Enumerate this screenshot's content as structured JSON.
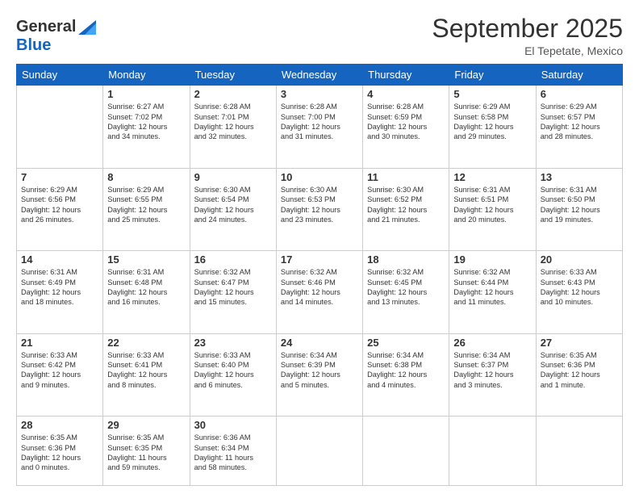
{
  "header": {
    "logo_general": "General",
    "logo_blue": "Blue",
    "month_title": "September 2025",
    "subtitle": "El Tepetate, Mexico"
  },
  "weekdays": [
    "Sunday",
    "Monday",
    "Tuesday",
    "Wednesday",
    "Thursday",
    "Friday",
    "Saturday"
  ],
  "weeks": [
    [
      {
        "day": "",
        "text": ""
      },
      {
        "day": "1",
        "text": "Sunrise: 6:27 AM\nSunset: 7:02 PM\nDaylight: 12 hours\nand 34 minutes."
      },
      {
        "day": "2",
        "text": "Sunrise: 6:28 AM\nSunset: 7:01 PM\nDaylight: 12 hours\nand 32 minutes."
      },
      {
        "day": "3",
        "text": "Sunrise: 6:28 AM\nSunset: 7:00 PM\nDaylight: 12 hours\nand 31 minutes."
      },
      {
        "day": "4",
        "text": "Sunrise: 6:28 AM\nSunset: 6:59 PM\nDaylight: 12 hours\nand 30 minutes."
      },
      {
        "day": "5",
        "text": "Sunrise: 6:29 AM\nSunset: 6:58 PM\nDaylight: 12 hours\nand 29 minutes."
      },
      {
        "day": "6",
        "text": "Sunrise: 6:29 AM\nSunset: 6:57 PM\nDaylight: 12 hours\nand 28 minutes."
      }
    ],
    [
      {
        "day": "7",
        "text": "Sunrise: 6:29 AM\nSunset: 6:56 PM\nDaylight: 12 hours\nand 26 minutes."
      },
      {
        "day": "8",
        "text": "Sunrise: 6:29 AM\nSunset: 6:55 PM\nDaylight: 12 hours\nand 25 minutes."
      },
      {
        "day": "9",
        "text": "Sunrise: 6:30 AM\nSunset: 6:54 PM\nDaylight: 12 hours\nand 24 minutes."
      },
      {
        "day": "10",
        "text": "Sunrise: 6:30 AM\nSunset: 6:53 PM\nDaylight: 12 hours\nand 23 minutes."
      },
      {
        "day": "11",
        "text": "Sunrise: 6:30 AM\nSunset: 6:52 PM\nDaylight: 12 hours\nand 21 minutes."
      },
      {
        "day": "12",
        "text": "Sunrise: 6:31 AM\nSunset: 6:51 PM\nDaylight: 12 hours\nand 20 minutes."
      },
      {
        "day": "13",
        "text": "Sunrise: 6:31 AM\nSunset: 6:50 PM\nDaylight: 12 hours\nand 19 minutes."
      }
    ],
    [
      {
        "day": "14",
        "text": "Sunrise: 6:31 AM\nSunset: 6:49 PM\nDaylight: 12 hours\nand 18 minutes."
      },
      {
        "day": "15",
        "text": "Sunrise: 6:31 AM\nSunset: 6:48 PM\nDaylight: 12 hours\nand 16 minutes."
      },
      {
        "day": "16",
        "text": "Sunrise: 6:32 AM\nSunset: 6:47 PM\nDaylight: 12 hours\nand 15 minutes."
      },
      {
        "day": "17",
        "text": "Sunrise: 6:32 AM\nSunset: 6:46 PM\nDaylight: 12 hours\nand 14 minutes."
      },
      {
        "day": "18",
        "text": "Sunrise: 6:32 AM\nSunset: 6:45 PM\nDaylight: 12 hours\nand 13 minutes."
      },
      {
        "day": "19",
        "text": "Sunrise: 6:32 AM\nSunset: 6:44 PM\nDaylight: 12 hours\nand 11 minutes."
      },
      {
        "day": "20",
        "text": "Sunrise: 6:33 AM\nSunset: 6:43 PM\nDaylight: 12 hours\nand 10 minutes."
      }
    ],
    [
      {
        "day": "21",
        "text": "Sunrise: 6:33 AM\nSunset: 6:42 PM\nDaylight: 12 hours\nand 9 minutes."
      },
      {
        "day": "22",
        "text": "Sunrise: 6:33 AM\nSunset: 6:41 PM\nDaylight: 12 hours\nand 8 minutes."
      },
      {
        "day": "23",
        "text": "Sunrise: 6:33 AM\nSunset: 6:40 PM\nDaylight: 12 hours\nand 6 minutes."
      },
      {
        "day": "24",
        "text": "Sunrise: 6:34 AM\nSunset: 6:39 PM\nDaylight: 12 hours\nand 5 minutes."
      },
      {
        "day": "25",
        "text": "Sunrise: 6:34 AM\nSunset: 6:38 PM\nDaylight: 12 hours\nand 4 minutes."
      },
      {
        "day": "26",
        "text": "Sunrise: 6:34 AM\nSunset: 6:37 PM\nDaylight: 12 hours\nand 3 minutes."
      },
      {
        "day": "27",
        "text": "Sunrise: 6:35 AM\nSunset: 6:36 PM\nDaylight: 12 hours\nand 1 minute."
      }
    ],
    [
      {
        "day": "28",
        "text": "Sunrise: 6:35 AM\nSunset: 6:36 PM\nDaylight: 12 hours\nand 0 minutes."
      },
      {
        "day": "29",
        "text": "Sunrise: 6:35 AM\nSunset: 6:35 PM\nDaylight: 11 hours\nand 59 minutes."
      },
      {
        "day": "30",
        "text": "Sunrise: 6:36 AM\nSunset: 6:34 PM\nDaylight: 11 hours\nand 58 minutes."
      },
      {
        "day": "",
        "text": ""
      },
      {
        "day": "",
        "text": ""
      },
      {
        "day": "",
        "text": ""
      },
      {
        "day": "",
        "text": ""
      }
    ]
  ]
}
